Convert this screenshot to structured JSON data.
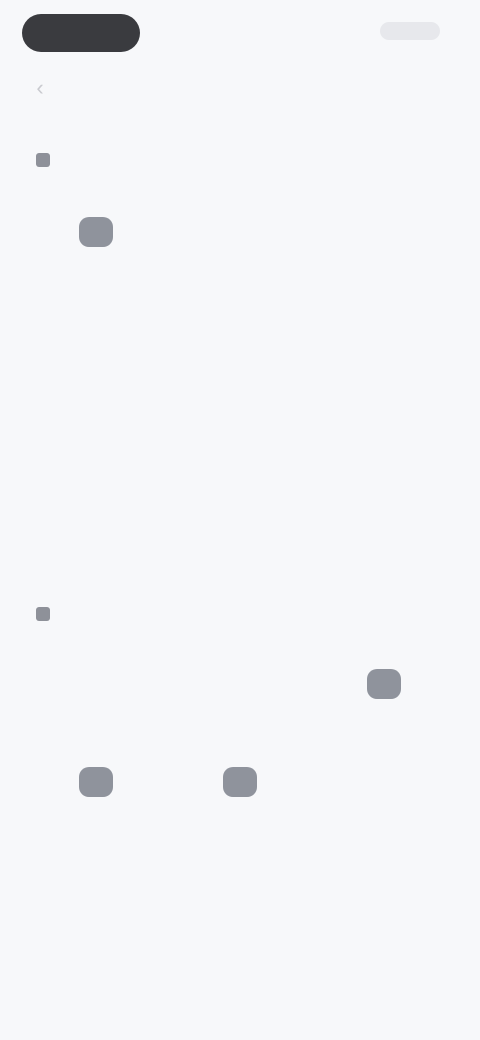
{
  "nav": {
    "title": "",
    "back_icon": "chevron-left-icon"
  },
  "sections": [
    {
      "title": "",
      "items": [
        {
          "label": "",
          "icon": "app-icon",
          "tone": "dark"
        },
        {
          "label": "",
          "icon": "app-icon",
          "tone": "light"
        },
        {
          "label": "",
          "icon": "app-icon",
          "tone": "light"
        },
        {
          "label": "",
          "icon": "app-icon",
          "tone": "light"
        },
        {
          "label": "",
          "icon": "app-icon",
          "tone": "light"
        },
        {
          "label": "",
          "icon": "app-icon",
          "tone": "light"
        },
        {
          "label": "",
          "icon": "app-icon",
          "tone": "light"
        },
        {
          "label": "",
          "icon": "app-icon",
          "tone": "light"
        },
        {
          "label": "",
          "icon": "app-icon",
          "tone": "light"
        },
        {
          "label": "",
          "icon": "app-icon",
          "tone": "light"
        }
      ]
    },
    {
      "title": "",
      "items": [
        {
          "label": "",
          "icon": "app-icon",
          "tone": "light"
        },
        {
          "label": "",
          "icon": "app-icon",
          "tone": "light"
        },
        {
          "label": "",
          "icon": "app-icon",
          "tone": "dark"
        },
        {
          "label": "",
          "icon": "app-icon",
          "tone": "dark"
        },
        {
          "label": "",
          "icon": "app-icon",
          "tone": "dark"
        },
        {
          "label": "",
          "icon": "app-icon",
          "tone": "light"
        },
        {
          "label": "",
          "icon": "app-icon",
          "tone": "light"
        },
        {
          "label": "",
          "icon": "app-icon",
          "tone": "light"
        },
        {
          "label": "",
          "icon": "app-icon",
          "tone": "light"
        },
        {
          "label": "",
          "icon": "app-icon",
          "tone": "light"
        },
        {
          "label": "",
          "icon": "app-icon",
          "tone": "light"
        }
      ]
    }
  ]
}
